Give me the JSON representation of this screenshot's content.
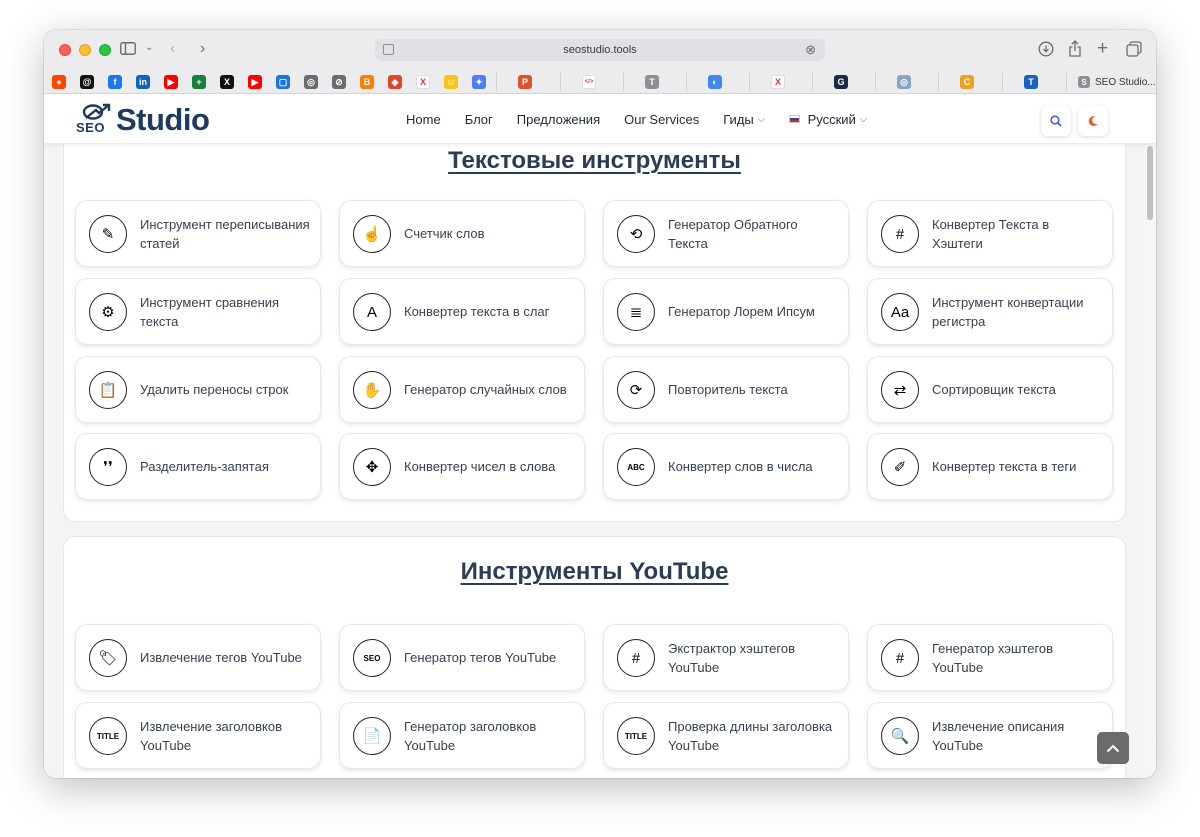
{
  "browser": {
    "url": "seostudio.tools",
    "favorites": [
      {
        "icon": "reddit-icon",
        "color": "#ff4500",
        "glyph": "●"
      },
      {
        "icon": "threads-icon",
        "color": "#111111",
        "glyph": "@"
      },
      {
        "icon": "facebook-icon",
        "color": "#1877f2",
        "glyph": "f"
      },
      {
        "icon": "linkedin-icon",
        "color": "#0a66c2",
        "glyph": "in"
      },
      {
        "icon": "youtube-icon",
        "color": "#ff0000",
        "glyph": "▶"
      },
      {
        "icon": "sheets-icon",
        "color": "#188038",
        "glyph": "+"
      },
      {
        "icon": "x-icon",
        "color": "#111111",
        "glyph": "X"
      },
      {
        "icon": "youtube-studio-icon",
        "color": "#ff0000",
        "glyph": "▶"
      },
      {
        "icon": "chat-icon",
        "color": "#1a73e8",
        "glyph": "▢"
      },
      {
        "icon": "globe-icon",
        "color": "#6b6b70",
        "glyph": "◎"
      },
      {
        "icon": "compass-icon",
        "color": "#6b6b70",
        "glyph": "⊘"
      },
      {
        "icon": "blogger-icon",
        "color": "#ff8000",
        "glyph": "B"
      },
      {
        "icon": "gitlab-icon",
        "color": "#e24329",
        "glyph": "◆"
      },
      {
        "icon": "x-tool-icon",
        "color": "#ffffff",
        "glyph": "X"
      },
      {
        "icon": "smiley-icon",
        "color": "#f5c518",
        "glyph": "☺"
      },
      {
        "icon": "sparkle-icon",
        "color": "#4f7cf7",
        "glyph": "✦"
      },
      {
        "icon": "producthunt-icon",
        "color": "#da552f",
        "glyph": "P"
      },
      {
        "icon": "code-icon",
        "color": "#ffffff",
        "glyph": "</>"
      },
      {
        "icon": "t-icon",
        "color": "#8e8e93",
        "glyph": "T"
      },
      {
        "icon": "pie-icon",
        "color": "#4285f4",
        "glyph": "◐"
      },
      {
        "icon": "x-red-icon",
        "color": "#ffffff",
        "glyph": "X"
      },
      {
        "icon": "g-dark-icon",
        "color": "#1e2a44",
        "glyph": "G"
      },
      {
        "icon": "globe-2-icon",
        "color": "#8aa4c8",
        "glyph": "◎"
      },
      {
        "icon": "c-icon",
        "color": "#f0a020",
        "glyph": "C"
      },
      {
        "icon": "t-blue-icon",
        "color": "#1565c0",
        "glyph": "T"
      }
    ],
    "last_tab": "SEO Studio...",
    "last_tab_glyph": "S"
  },
  "header": {
    "logo_seo": "SEO",
    "logo_studio": "Studio",
    "nav": {
      "home": "Home",
      "blog": "Блог",
      "offers": "Предложения",
      "services": "Our Services",
      "guides": "Гиды",
      "language": "Русский"
    }
  },
  "sections": [
    {
      "title": "Текстовые инструменты",
      "tools": [
        {
          "label": "Инструмент переписывания статей",
          "icon": "rewrite-icon",
          "glyph": "✎"
        },
        {
          "label": "Счетчик слов",
          "icon": "counter-icon",
          "glyph": "☝"
        },
        {
          "label": "Генератор Обратного Текста",
          "icon": "reverse-text-icon",
          "glyph": "⟲"
        },
        {
          "label": "Конвертер Текста в Хэштеги",
          "icon": "hashtag-icon",
          "glyph": "#"
        },
        {
          "label": "Инструмент сравнения текста",
          "icon": "compare-icon",
          "glyph": "⚙"
        },
        {
          "label": "Конвертер текста в слаг",
          "icon": "slug-icon",
          "glyph": "A"
        },
        {
          "label": "Генератор Лорем Ипсум",
          "icon": "lorem-icon",
          "glyph": "≣"
        },
        {
          "label": "Инструмент конвертации регистра",
          "icon": "case-icon",
          "glyph": "Aa"
        },
        {
          "label": "Удалить переносы строк",
          "icon": "clipboard-icon",
          "glyph": "📋"
        },
        {
          "label": "Генератор случайных слов",
          "icon": "random-words-icon",
          "glyph": "✋"
        },
        {
          "label": "Повторитель текста",
          "icon": "repeat-icon",
          "glyph": "⟳"
        },
        {
          "label": "Сортировщик текста",
          "icon": "sort-icon",
          "glyph": "⇄"
        },
        {
          "label": "Разделитель-запятая",
          "icon": "comma-icon",
          "glyph": "❜❜"
        },
        {
          "label": "Конвертер чисел в слова",
          "icon": "puzzle-icon",
          "glyph": "✥"
        },
        {
          "label": "Конвертер слов в числа",
          "icon": "abc-icon",
          "glyph": "ABC"
        },
        {
          "label": "Конвертер текста в теги",
          "icon": "tag-pen-icon",
          "glyph": "✐"
        }
      ]
    },
    {
      "title": "Инструменты YouTube",
      "tools": [
        {
          "label": "Извлечение тегов YouTube",
          "icon": "yt-tag-extract-icon",
          "glyph": "🏷"
        },
        {
          "label": "Генератор тегов YouTube",
          "icon": "yt-tag-gen-icon",
          "glyph": "SEO"
        },
        {
          "label": "Экстрактор хэштегов YouTube",
          "icon": "yt-hashtag-extract-icon",
          "glyph": "#"
        },
        {
          "label": "Генератор хэштегов YouTube",
          "icon": "yt-hashtag-gen-icon",
          "glyph": "#"
        },
        {
          "label": "Извлечение заголовков YouTube",
          "icon": "yt-title-extract-icon",
          "glyph": "TITLE"
        },
        {
          "label": "Генератор заголовков YouTube",
          "icon": "yt-title-gen-icon",
          "glyph": "📄"
        },
        {
          "label": "Проверка длины заголовка YouTube",
          "icon": "yt-title-length-icon",
          "glyph": "TITLE"
        },
        {
          "label": "Извлечение описания YouTube",
          "icon": "yt-description-icon",
          "glyph": "🔍"
        }
      ]
    }
  ],
  "colors": {
    "brand_navy": "#1e3a5f",
    "heading": "#2b3d55",
    "moon": "#e0642b",
    "search": "#4a5fd0"
  }
}
